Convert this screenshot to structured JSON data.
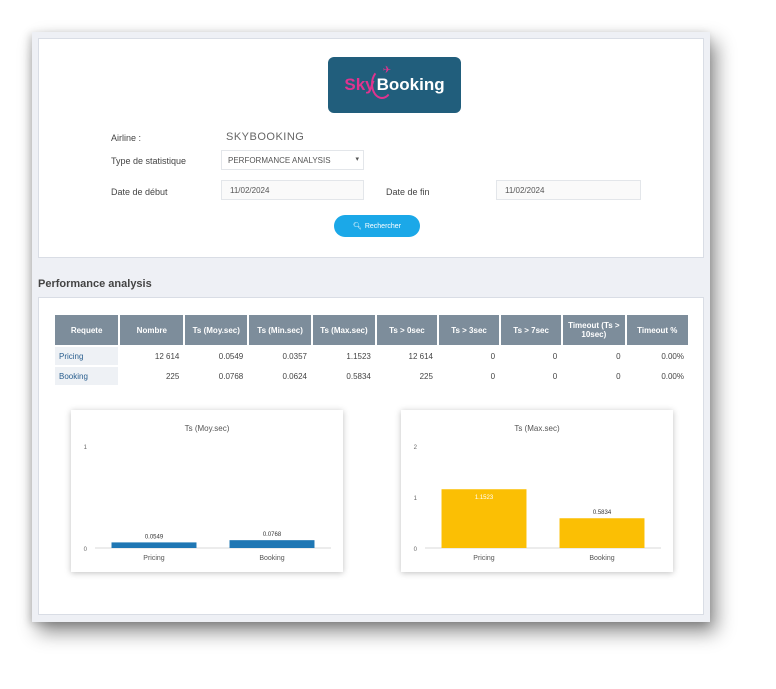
{
  "logo": {
    "sky": "Sky",
    "booking": "Booking"
  },
  "form": {
    "airline_label": "Airline :",
    "airline_value": "SKYBOOKING",
    "type_label": "Type de statistique",
    "type_value": "PERFORMANCE ANALYSIS",
    "start_label": "Date de début",
    "start_value": "11/02/2024",
    "end_label": "Date de fin",
    "end_value": "11/02/2024",
    "search_label": "Rechercher"
  },
  "section_title": "Performance analysis",
  "table": {
    "headers": [
      "Requete",
      "Nombre",
      "Ts (Moy.sec)",
      "Ts (Min.sec)",
      "Ts (Max.sec)",
      "Ts > 0sec",
      "Ts > 3sec",
      "Ts > 7sec",
      "Timeout (Ts > 10sec)",
      "Timeout %"
    ],
    "rows": [
      [
        "Pricing",
        "12 614",
        "0.0549",
        "0.0357",
        "1.1523",
        "12 614",
        "0",
        "0",
        "0",
        "0.00%"
      ],
      [
        "Booking",
        "225",
        "0.0768",
        "0.0624",
        "0.5834",
        "225",
        "0",
        "0",
        "0",
        "0.00%"
      ]
    ]
  },
  "chart_data": [
    {
      "type": "bar",
      "title": "Ts (Moy.sec)",
      "categories": [
        "Pricing",
        "Booking"
      ],
      "values": [
        0.0549,
        0.0768
      ],
      "value_labels": [
        "0.0549",
        "0.0768"
      ],
      "ylim": [
        0,
        1
      ],
      "yticks": [
        "0",
        "1"
      ],
      "color": "#1f77b4"
    },
    {
      "type": "bar",
      "title": "Ts (Max.sec)",
      "categories": [
        "Pricing",
        "Booking"
      ],
      "values": [
        1.1523,
        0.5834
      ],
      "value_labels": [
        "1.1523",
        "0.5834"
      ],
      "ylim": [
        0,
        2
      ],
      "yticks": [
        "0",
        "1",
        "2"
      ],
      "color": "#fbbf04"
    }
  ]
}
